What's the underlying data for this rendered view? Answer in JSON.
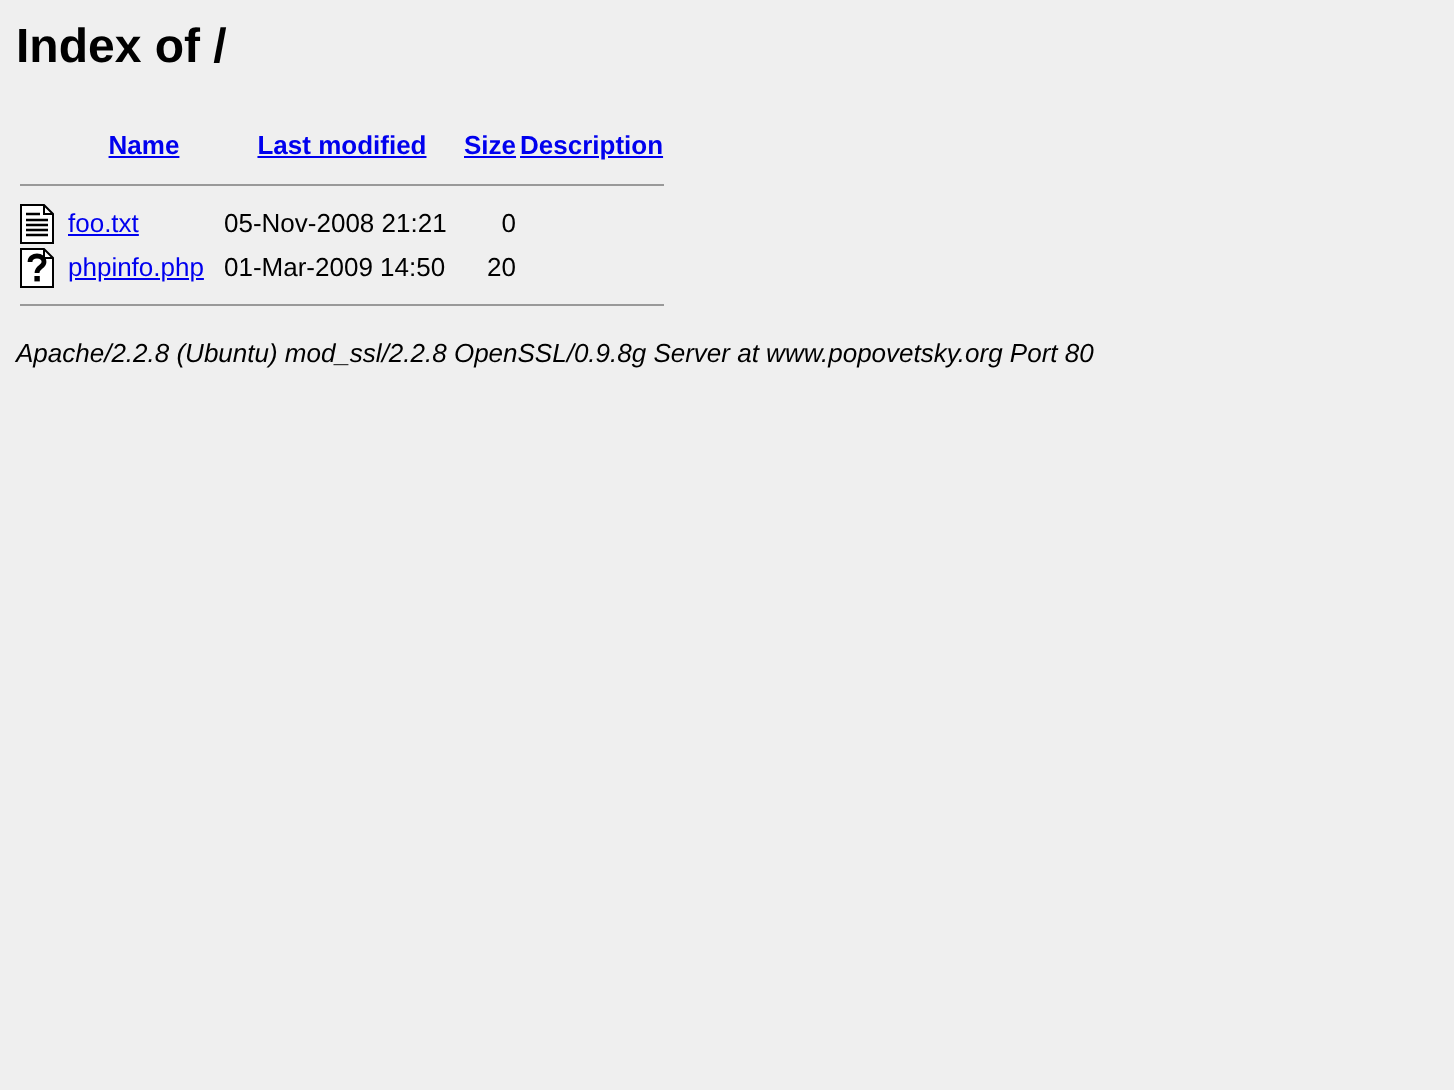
{
  "title": "Index of /",
  "columns": [
    "Name",
    "Last modified",
    "Size",
    "Description"
  ],
  "rows": [
    {
      "kind": "text",
      "name": "foo.txt",
      "modified": "05-Nov-2008 21:21",
      "size": "0"
    },
    {
      "kind": "unknown",
      "name": "phpinfo.php",
      "modified": "01-Mar-2009 14:50",
      "size": "20"
    }
  ],
  "footer": "Apache/2.2.8 (Ubuntu) mod_ssl/2.2.8 OpenSSL/0.9.8g Server at www.popovetsky.org Port 80"
}
